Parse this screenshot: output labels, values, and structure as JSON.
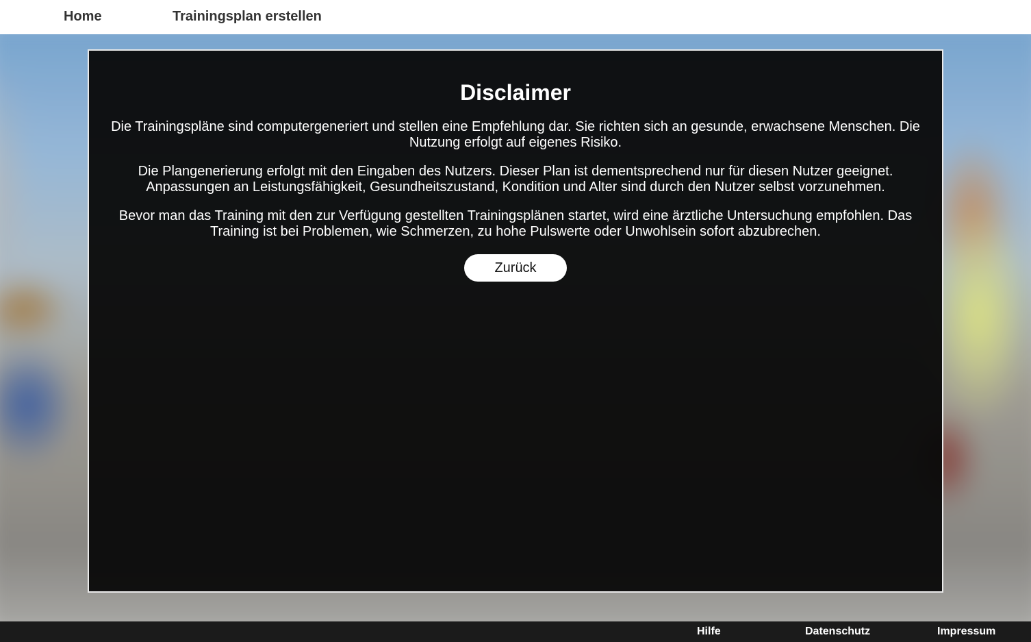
{
  "nav": {
    "home": "Home",
    "plan": "Trainingsplan erstellen"
  },
  "disclaimer": {
    "title": "Disclaimer",
    "paragraphs": [
      "Die Trainingspläne sind computergeneriert und stellen eine Empfehlung dar. Sie richten sich an gesunde, erwachsene Menschen. Die Nutzung erfolgt auf eigenes Risiko.",
      "Die Plangenerierung erfolgt mit den Eingaben des Nutzers. Dieser Plan ist dementsprechend nur für diesen Nutzer geeignet. Anpassungen an Leistungsfähigkeit, Gesundheitszustand, Kondition und Alter sind durch den Nutzer selbst vorzunehmen.",
      "Bevor man das Training mit den zur Verfügung gestellten Trainingsplänen startet, wird eine ärztliche Untersuchung empfohlen. Das Training ist bei Problemen, wie Schmerzen, zu hohe Pulswerte oder Unwohlsein sofort abzubrechen."
    ],
    "back_label": "Zurück"
  },
  "footer": {
    "help": "Hilfe",
    "privacy": "Datenschutz",
    "imprint": "Impressum"
  },
  "colors": {
    "panel_background": "#080808",
    "panel_border": "#e9e9e9",
    "footer_background": "#1b1b1b",
    "nav_text": "#333333"
  }
}
